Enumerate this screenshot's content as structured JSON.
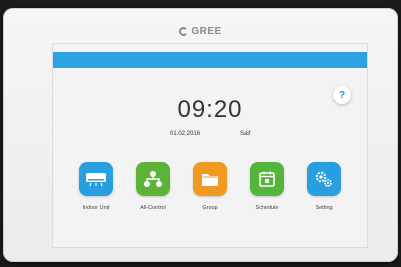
{
  "brand": {
    "name": "GREE"
  },
  "clock": {
    "time": "09:20",
    "date": "01.02.2016",
    "day": "Saif"
  },
  "help": {
    "label": "?"
  },
  "menu": [
    {
      "label": "Indoor Unit",
      "color": "#2a9fe0",
      "icon": "indoor-unit-icon"
    },
    {
      "label": "All-Control",
      "color": "#5db33a",
      "icon": "all-control-icon"
    },
    {
      "label": "Group",
      "color": "#f09a22",
      "icon": "folder-icon"
    },
    {
      "label": "Schedule",
      "color": "#55b43b",
      "icon": "calendar-icon"
    },
    {
      "label": "Setting",
      "color": "#2a9fe0",
      "icon": "gears-icon"
    }
  ]
}
